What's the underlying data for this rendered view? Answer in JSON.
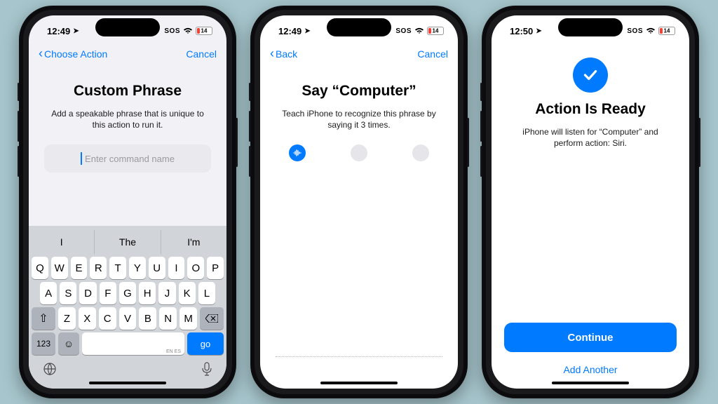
{
  "status": {
    "time_a": "12:49",
    "time_b": "12:49",
    "time_c": "12:50",
    "sos": "SOS",
    "battery_pct": "14",
    "battery_fill_width": "22%"
  },
  "screen1": {
    "nav_back": "Choose Action",
    "nav_cancel": "Cancel",
    "title": "Custom Phrase",
    "subtitle": "Add a speakable phrase that is unique to this action to run it.",
    "placeholder": "Enter command name"
  },
  "keyboard": {
    "predictions": [
      "I",
      "The",
      "I'm"
    ],
    "row1": [
      "Q",
      "W",
      "E",
      "R",
      "T",
      "Y",
      "U",
      "I",
      "O",
      "P"
    ],
    "row2": [
      "A",
      "S",
      "D",
      "F",
      "G",
      "H",
      "J",
      "K",
      "L"
    ],
    "row3": [
      "Z",
      "X",
      "C",
      "V",
      "B",
      "N",
      "M"
    ],
    "num_key": "123",
    "go_key": "go",
    "space_sub": "EN ES"
  },
  "screen2": {
    "nav_back": "Back",
    "nav_cancel": "Cancel",
    "title": "Say “Computer”",
    "subtitle": "Teach iPhone to recognize this phrase by saying it 3 times."
  },
  "screen3": {
    "title": "Action Is Ready",
    "subtitle": "iPhone will listen for “Computer” and perform action: Siri.",
    "primary": "Continue",
    "secondary": "Add Another"
  }
}
